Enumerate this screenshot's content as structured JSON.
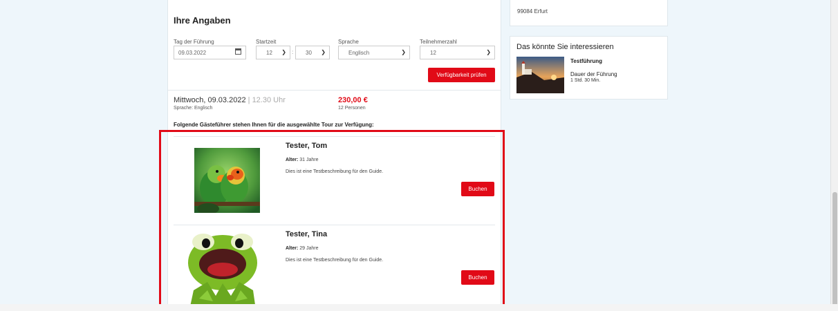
{
  "form": {
    "title": "Ihre Angaben",
    "date_label": "Tag der Führung",
    "date_value": "09.03.2022",
    "start_label": "Startzeit",
    "hour_value": "12",
    "minute_separator": ":",
    "minute_value": "30",
    "language_label": "Sprache",
    "language_value": "Englisch",
    "participants_label": "Teilnehmerzahl",
    "participants_value": "12",
    "check_button": "Verfügbarkeit prüfen"
  },
  "summary": {
    "date": "Mittwoch, 09.03.2022",
    "separator": " | ",
    "time": "12.30 Uhr",
    "language_line": "Sprache: Englisch",
    "price": "230,00 €",
    "persons": "12 Personen",
    "guides_intro": "Folgende Gästeführer stehen Ihnen für die ausgewählte Tour zur Verfügung:"
  },
  "guides": [
    {
      "name": "Tester, Tom",
      "age_label": "Alter:",
      "age_value": "31 Jahre",
      "description": "Dies ist eine Testbeschreibung für den Guide.",
      "book_label": "Buchen",
      "image": "parrots-photo"
    },
    {
      "name": "Tester, Tina",
      "age_label": "Alter:",
      "age_value": "29 Jahre",
      "description": "Dies ist eine Testbeschreibung für den Guide.",
      "book_label": "Buchen",
      "image": "frog-puppet-photo"
    }
  ],
  "sidebar": {
    "address_line": "99084 Erfurt",
    "recommend_title": "Das könnte Sie interessieren",
    "rec_item_title": "Testführung",
    "rec_item_duration_label": "Dauer der Führung",
    "rec_item_duration_value": "1 Std. 30 Min.",
    "rec_item_image": "lighthouse-sunset-photo"
  },
  "colors": {
    "accent": "#e10a17",
    "background": "#eef6fb"
  }
}
